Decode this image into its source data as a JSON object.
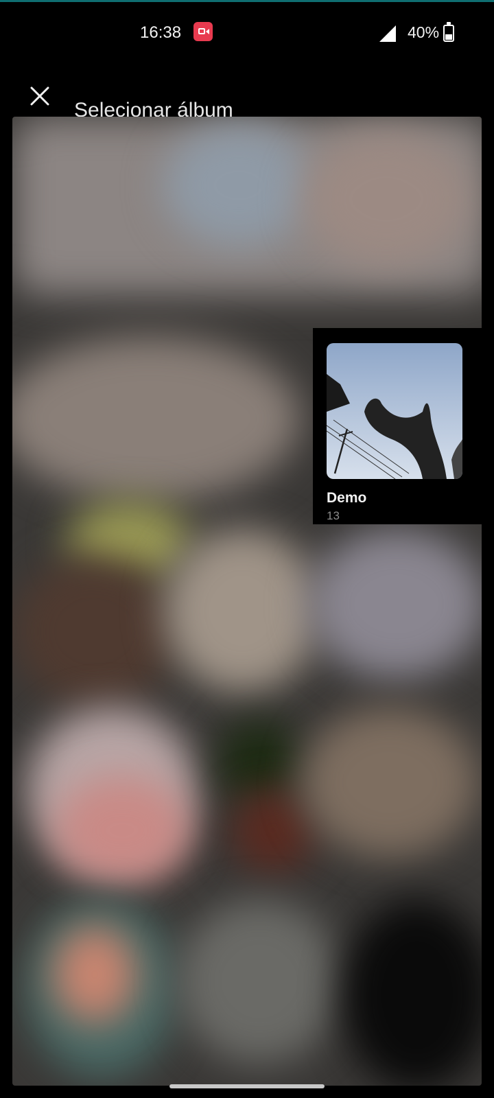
{
  "status_bar": {
    "time": "16:38",
    "battery": "40%",
    "battery_level": 0.4,
    "icons": [
      "screen-record-icon",
      "signal-icon",
      "battery-icon"
    ],
    "record_color": "#e83a4f"
  },
  "header": {
    "title": "Selecionar álbum",
    "close_icon": "close-icon"
  },
  "albums": [
    {
      "name": "Demo",
      "count": "13"
    }
  ],
  "colors": {
    "background": "#000000",
    "text_primary": "#f2f2f2",
    "text_secondary": "#8c8c8c"
  }
}
